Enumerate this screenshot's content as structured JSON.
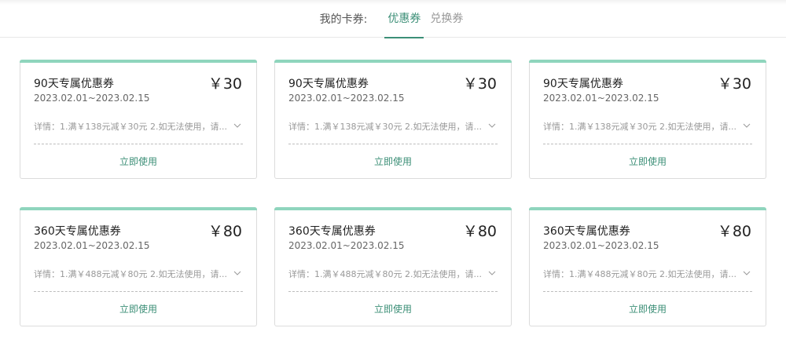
{
  "header": {
    "label": "我的卡券:",
    "tabs": [
      {
        "label": "优惠券",
        "active": true
      },
      {
        "label": "兑换券",
        "active": false
      }
    ]
  },
  "colors": {
    "accent": "#3c8f77",
    "card_top_bar": "#8fd5bd"
  },
  "coupons": [
    {
      "title": "90天专属优惠券",
      "price": "￥30",
      "date": "2023.02.01~2023.02.15",
      "detail": "详情：1.满￥138元减￥30元 2.如无法使用，请...",
      "expand_icon": "chevron-down-icon",
      "action": "立即使用"
    },
    {
      "title": "90天专属优惠券",
      "price": "￥30",
      "date": "2023.02.01~2023.02.15",
      "detail": "详情：1.满￥138元减￥30元 2.如无法使用，请...",
      "expand_icon": "chevron-down-icon",
      "action": "立即使用"
    },
    {
      "title": "90天专属优惠券",
      "price": "￥30",
      "date": "2023.02.01~2023.02.15",
      "detail": "详情：1.满￥138元减￥30元 2.如无法使用，请...",
      "expand_icon": "chevron-down-icon",
      "action": "立即使用"
    },
    {
      "title": "360天专属优惠券",
      "price": "￥80",
      "date": "2023.02.01~2023.02.15",
      "detail": "详情：1.满￥488元减￥80元 2.如无法使用，请...",
      "expand_icon": "chevron-down-icon",
      "action": "立即使用"
    },
    {
      "title": "360天专属优惠券",
      "price": "￥80",
      "date": "2023.02.01~2023.02.15",
      "detail": "详情：1.满￥488元减￥80元 2.如无法使用，请...",
      "expand_icon": "chevron-down-icon",
      "action": "立即使用"
    },
    {
      "title": "360天专属优惠券",
      "price": "￥80",
      "date": "2023.02.01~2023.02.15",
      "detail": "详情：1.满￥488元减￥80元 2.如无法使用，请...",
      "expand_icon": "chevron-down-icon",
      "action": "立即使用"
    }
  ]
}
